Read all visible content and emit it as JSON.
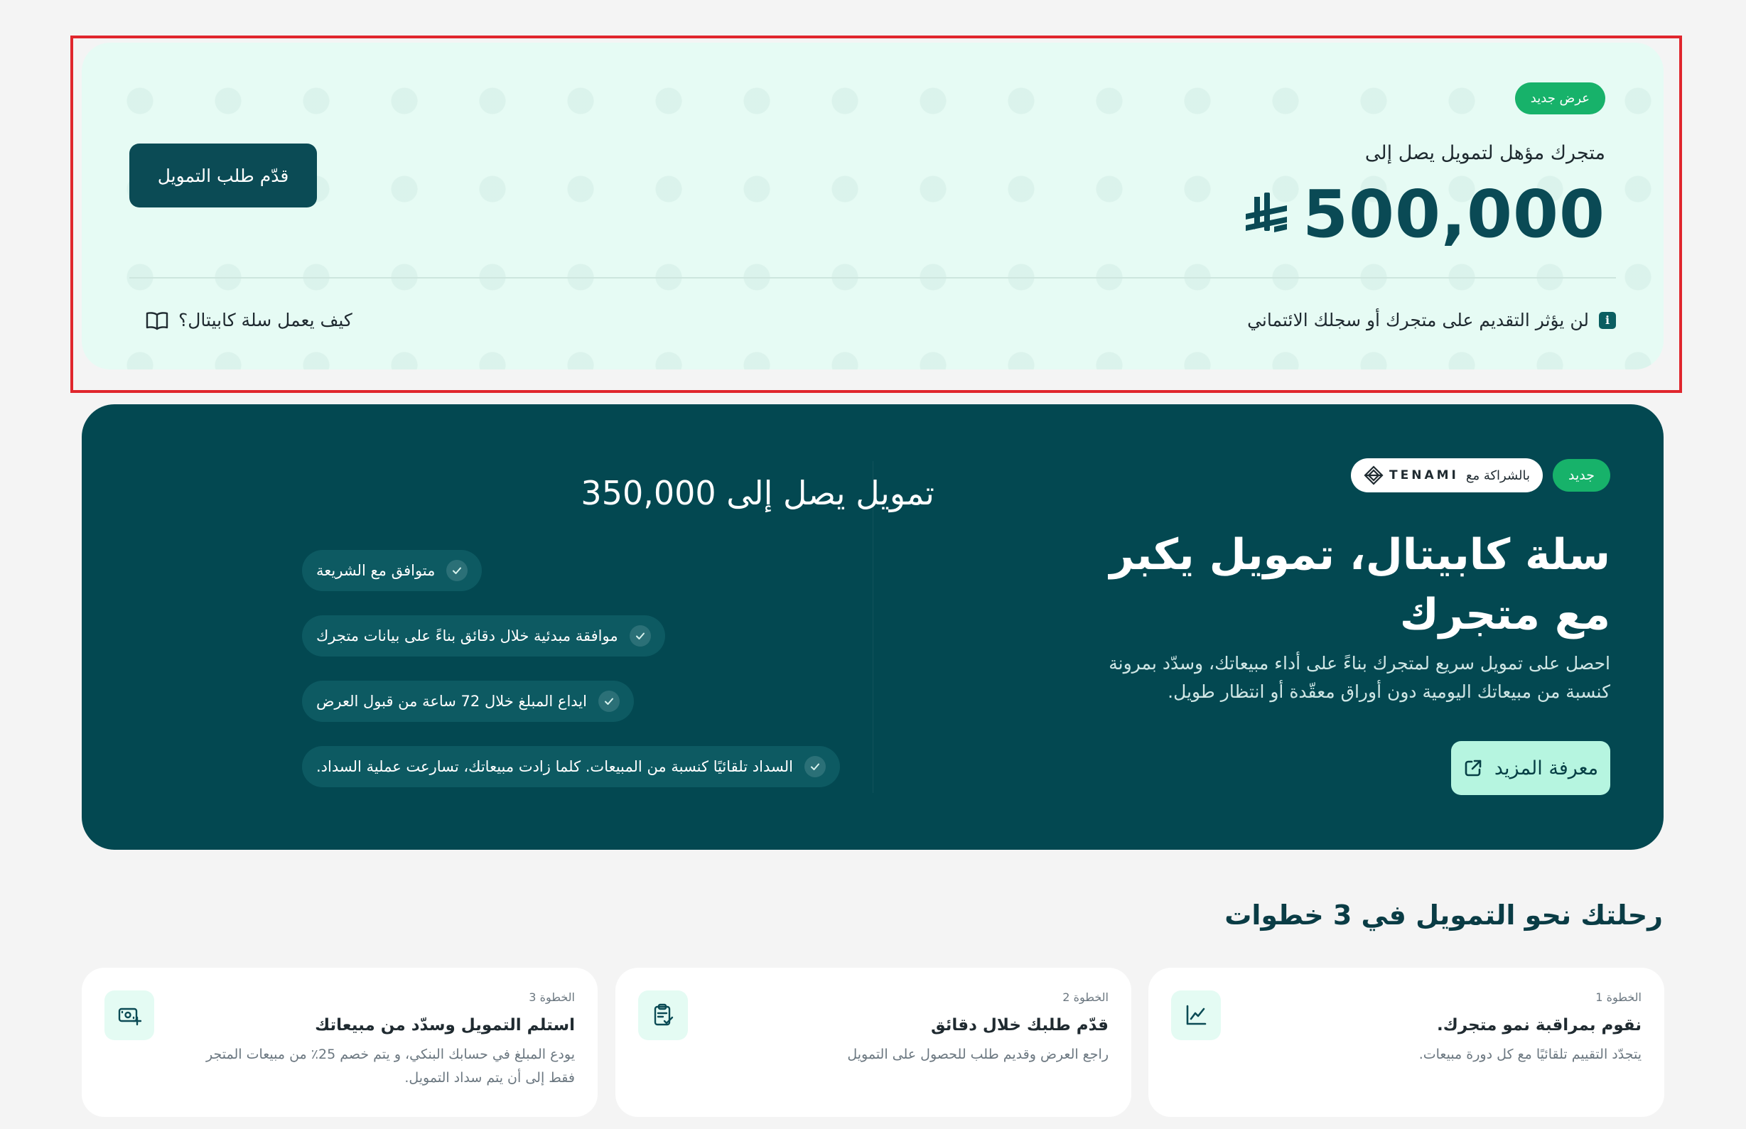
{
  "offer": {
    "badge": "عرض جديد",
    "eligible_text": "متجرك مؤهل لتمويل يصل إلى",
    "amount": "500,000",
    "currency_icon": "saudi-riyal-icon",
    "apply_label": "قدّم طلب التمويل",
    "note": "لن يؤثر التقديم على متجرك أو سجلك الائتماني",
    "info_icon": "i",
    "how_it_works_label": "كيف يعمل سلة كابيتال؟"
  },
  "promo": {
    "new_badge": "جديد",
    "partner_label": "بالشراكة مع",
    "partner_name": "TENAMI",
    "title": "سلة كابيتال، تمويل يكبر مع متجرك",
    "description": "احصل على تمويل سريع لمتجرك بناءً على أداء مبيعاتك، وسدّد بمرونة كنسبة من مبيعاتك اليومية دون أوراق معقّدة أو انتظار طويل.",
    "learn_more_label": "معرفة المزيد",
    "funding_heading": "تمويل يصل إلى 350,000",
    "features": [
      "متوافق مع الشريعة",
      "موافقة مبدئية خلال دقائق بناءً على بيانات متجرك",
      "ايداع المبلغ خلال 72 ساعة من قبول العرض",
      "السداد تلقائيًا كنسبة من المبيعات. كلما زادت مبيعاتك، تسارعت عملية السداد."
    ]
  },
  "steps": {
    "title": "رحلتك نحو التمويل في 3 خطوات",
    "items": [
      {
        "label": "الخطوة 1",
        "title": "نقوم بمراقبة نمو متجرك.",
        "description": "يتجدّد التقييم تلقائيًا مع كل دورة مبيعات.",
        "icon": "growth-chart-icon"
      },
      {
        "label": "الخطوة 2",
        "title": "قدّم طلبك خلال دقائق",
        "description": "راجع العرض وقديم طلب للحصول على التمويل",
        "icon": "clipboard-check-icon"
      },
      {
        "label": "الخطوة 3",
        "title": "استلم التمويل وسدّد من مبيعاتك",
        "description": "يودع المبلغ في حسابك البنكي، و يتم خصم 25٪ من مبيعات المتجر فقط إلى أن يتم سداد التمويل.",
        "icon": "cash-plus-icon"
      }
    ]
  },
  "colors": {
    "accent_dark": "#034851",
    "accent_green": "#17b26a",
    "offer_bg": "#e6fbf4",
    "highlight_border": "#e0262d",
    "learn_more_bg": "#b6f5e0"
  }
}
